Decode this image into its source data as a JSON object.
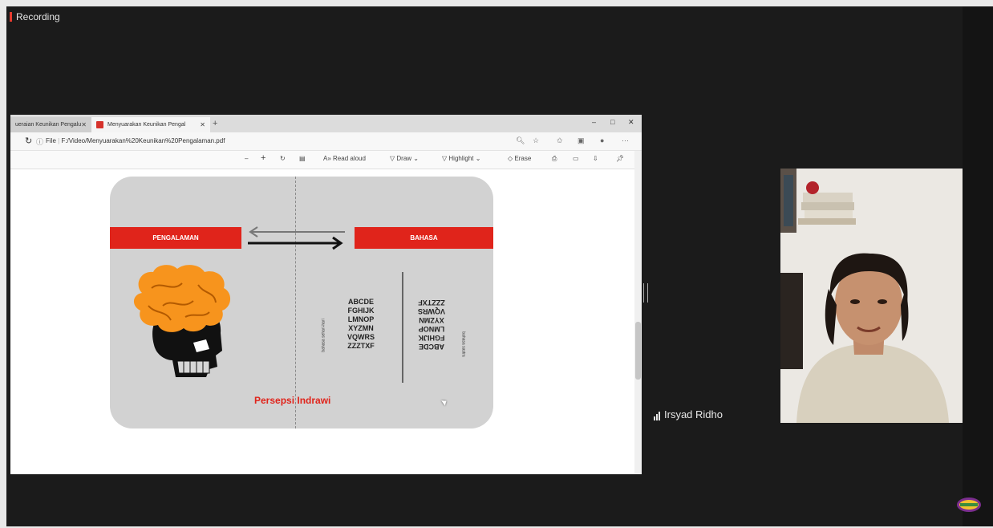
{
  "recording": {
    "label": "Recording"
  },
  "browser": {
    "tabs": [
      {
        "label": "ueraian Keunikan Pengalu",
        "active": false
      },
      {
        "label": "Menyuarakan Keunikan Pengal",
        "active": true
      }
    ],
    "new_tab": "+",
    "window_controls": {
      "minimize": "–",
      "restore": "□",
      "close": "✕"
    },
    "address": {
      "protocol": "File",
      "url": "F:/Video/Menyuarakan%20Keunikan%20Pengalaman.pdf"
    },
    "toolbar": {
      "zoom_out": "–",
      "zoom_in": "+",
      "read_aloud": "Read aloud",
      "draw": "Draw",
      "highlight": "Highlight",
      "erase": "Erase"
    }
  },
  "slide": {
    "left_header": "PENGALAMAN",
    "right_header": "BAHASA",
    "letters_left": [
      "ABCDE",
      "FGHIJK",
      "LMNOP",
      "XYZMN",
      "VQWRS",
      "ZZZTXF"
    ],
    "letters_right": [
      "ABCDE",
      "FGHIJK",
      "LMNOP",
      "XYZMN",
      "VQWRS",
      "ZZZTXF"
    ],
    "vertical_label_left": "bahasa sehari-hari",
    "vertical_label_right": "bahasa sastra",
    "caption": "Persepsi Indrawi",
    "colors": {
      "accent_red": "#e0241b",
      "brain_orange": "#f7941d",
      "card_gray": "#d2d2d2"
    }
  },
  "participant": {
    "name": "Irsyad Ridho"
  }
}
